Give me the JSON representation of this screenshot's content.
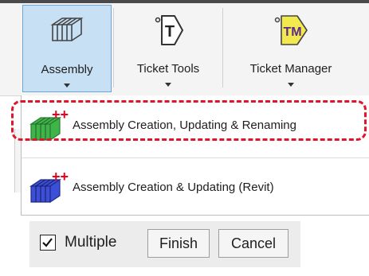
{
  "ribbon": {
    "buttons": [
      {
        "label": "Assembly"
      },
      {
        "label": "Ticket Tools"
      },
      {
        "label": "Ticket Manager"
      }
    ],
    "ticket_tools_glyph": "T",
    "ticket_manager_glyph": "TM"
  },
  "menu": {
    "items": [
      {
        "label": "Assembly Creation, Updating & Renaming",
        "icon": "assembly-green-icon"
      },
      {
        "label": "Assembly Creation & Updating (Revit)",
        "icon": "assembly-blue-icon"
      }
    ],
    "plus_glyph": "++"
  },
  "toolbar": {
    "multiple_label": "Multiple",
    "multiple_checked": true,
    "finish_label": "Finish",
    "cancel_label": "Cancel"
  },
  "colors": {
    "selected_bg": "#c7e0f4",
    "highlight": "#e0142a",
    "green": "#3fb549",
    "blue": "#3c4fd6",
    "plus_red": "#e8001f",
    "tm_yellow": "#f2e94e"
  }
}
